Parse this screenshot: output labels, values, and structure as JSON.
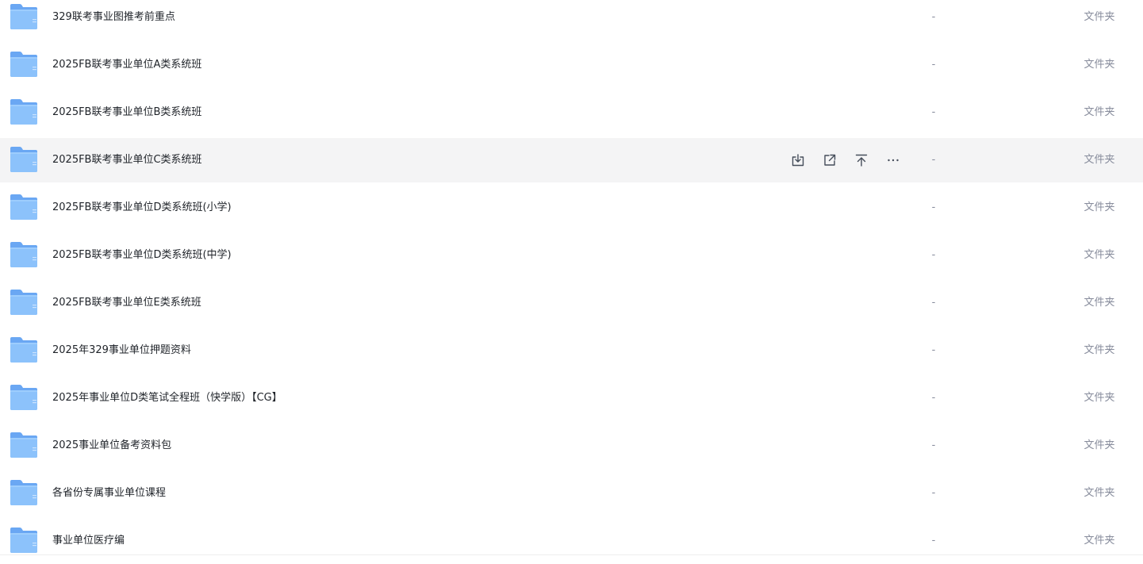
{
  "colors": {
    "folder_back": "#6aa7f3",
    "folder_front": "#8cc2fb",
    "folder_highlight": "#a9d3ff",
    "row_hover_bg": "#f4f4f5",
    "meta_text": "#878c9c",
    "action_icon": "#454d5a"
  },
  "row_actions": [
    {
      "name": "download-icon"
    },
    {
      "name": "share-icon"
    },
    {
      "name": "move-to-top-icon"
    },
    {
      "name": "more-icon"
    }
  ],
  "files": [
    {
      "name": "329联考事业图推考前重点",
      "size": "-",
      "type": "文件夹"
    },
    {
      "name": "2025FB联考事业单位A类系统班",
      "size": "-",
      "type": "文件夹"
    },
    {
      "name": "2025FB联考事业单位B类系统班",
      "size": "-",
      "type": "文件夹"
    },
    {
      "name": "2025FB联考事业单位C类系统班",
      "size": "-",
      "type": "文件夹",
      "hovered": true
    },
    {
      "name": "2025FB联考事业单位D类系统班(小学)",
      "size": "-",
      "type": "文件夹"
    },
    {
      "name": "2025FB联考事业单位D类系统班(中学)",
      "size": "-",
      "type": "文件夹"
    },
    {
      "name": "2025FB联考事业单位E类系统班",
      "size": "-",
      "type": "文件夹"
    },
    {
      "name": "2025年329事业单位押题资料",
      "size": "-",
      "type": "文件夹"
    },
    {
      "name": "2025年事业单位D类笔试全程班（快学版）【CG】",
      "size": "-",
      "type": "文件夹"
    },
    {
      "name": "2025事业单位备考资料包",
      "size": "-",
      "type": "文件夹"
    },
    {
      "name": "各省份专属事业单位课程",
      "size": "-",
      "type": "文件夹"
    },
    {
      "name": "事业单位医疗编",
      "size": "-",
      "type": "文件夹"
    }
  ]
}
